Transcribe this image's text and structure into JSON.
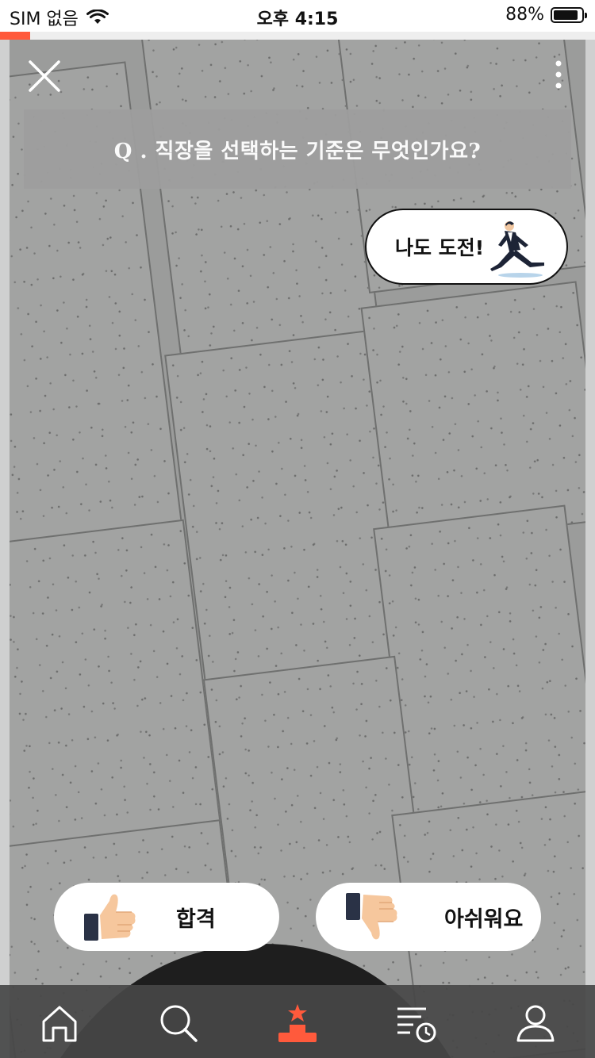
{
  "status_bar": {
    "carrier": "SIM 없음",
    "time": "오후 4:15",
    "battery_percent": "88%",
    "battery_level": 0.88
  },
  "story_progress": 0.05,
  "question": {
    "text": "Q . 직장을 선택하는 기준은 무엇인가요?"
  },
  "challenge_button": {
    "label": "나도 도전!",
    "icon": "running-businessman-icon"
  },
  "votes": {
    "pass": {
      "label": "합격",
      "icon": "thumbs-up-icon"
    },
    "fail": {
      "label": "아쉬워요",
      "icon": "thumbs-down-icon"
    }
  },
  "bottom_nav": {
    "items": [
      {
        "name": "home",
        "icon": "home-icon"
      },
      {
        "name": "search",
        "icon": "search-icon"
      },
      {
        "name": "ranking",
        "icon": "podium-star-icon",
        "active": true
      },
      {
        "name": "history",
        "icon": "list-clock-icon"
      },
      {
        "name": "profile",
        "icon": "user-icon"
      }
    ]
  },
  "colors": {
    "accent": "#ff5a3c",
    "nav_bg": "#464646",
    "question_bg": "#9e9e9e"
  }
}
